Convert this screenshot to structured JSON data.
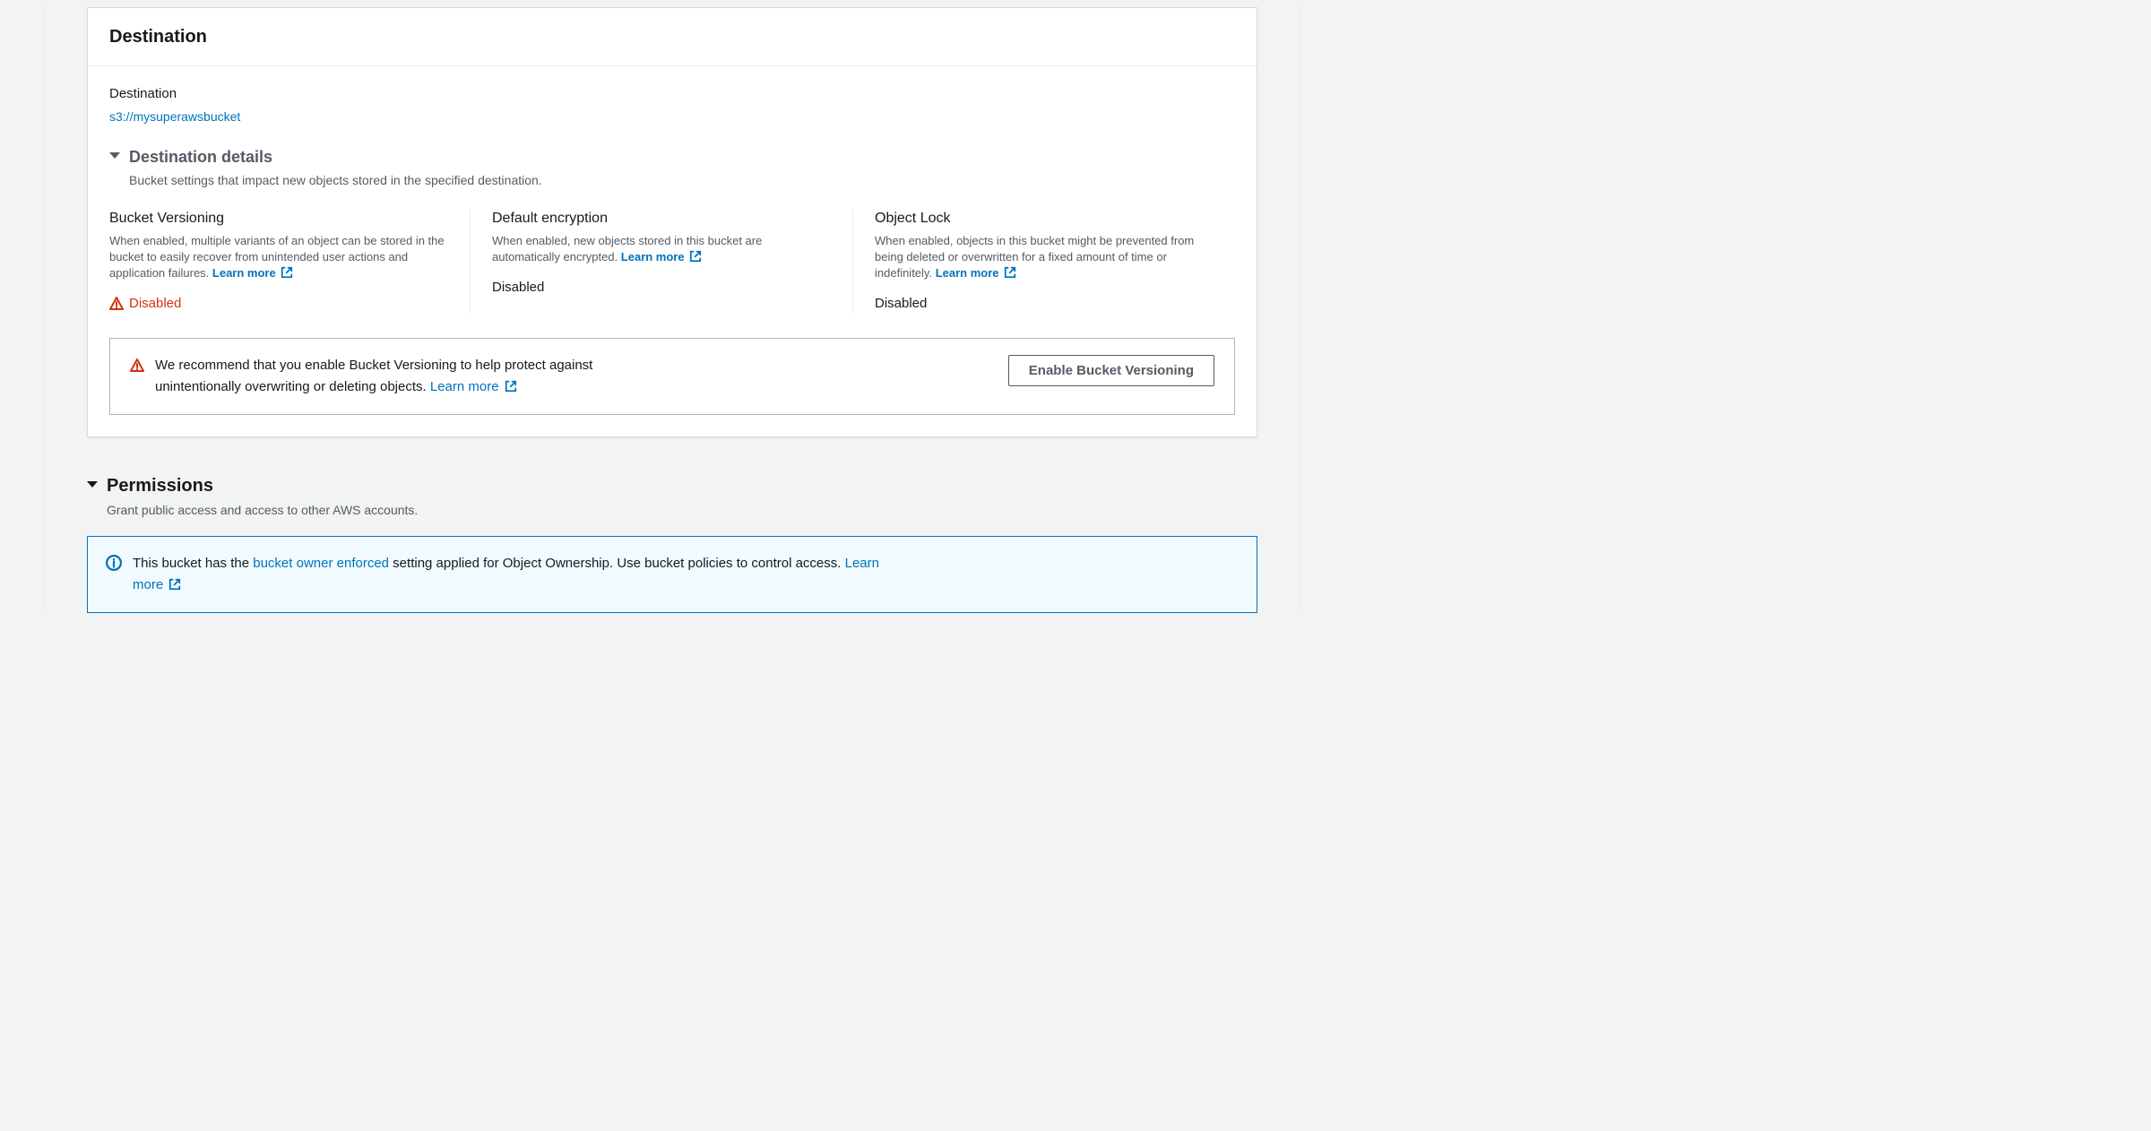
{
  "destination_panel": {
    "title": "Destination",
    "field_label": "Destination",
    "bucket_uri": "s3://mysuperawsbucket",
    "details": {
      "heading": "Destination details",
      "subtext": "Bucket settings that impact new objects stored in the specified destination."
    },
    "columns": {
      "versioning": {
        "heading": "Bucket Versioning",
        "desc": "When enabled, multiple variants of an object can be stored in the bucket to easily recover from unintended user actions and application failures. ",
        "learn_more": "Learn more",
        "status": "Disabled"
      },
      "encryption": {
        "heading": "Default encryption",
        "desc": "When enabled, new objects stored in this bucket are automatically encrypted. ",
        "learn_more": "Learn more",
        "status": "Disabled"
      },
      "object_lock": {
        "heading": "Object Lock",
        "desc": "When enabled, objects in this bucket might be prevented from being deleted or overwritten for a fixed amount of time or indefinitely. ",
        "learn_more": "Learn more",
        "status": "Disabled"
      }
    },
    "recommendation": {
      "text": "We recommend that you enable Bucket Versioning to help protect against unintentionally overwriting or deleting objects. ",
      "learn_more": "Learn more",
      "button": "Enable Bucket Versioning"
    }
  },
  "permissions": {
    "heading": "Permissions",
    "subtext": "Grant public access and access to other AWS accounts.",
    "banner": {
      "prefix": "This bucket has the ",
      "link_text": "bucket owner enforced",
      "suffix": " setting applied for Object Ownership. Use bucket policies to control access. ",
      "learn_more": "Learn more"
    }
  }
}
